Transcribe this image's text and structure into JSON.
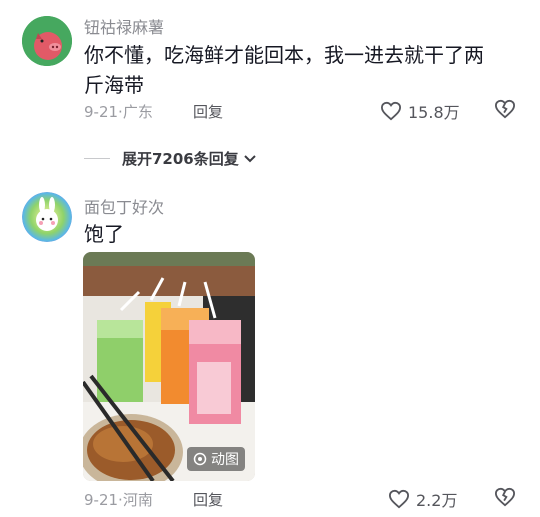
{
  "comments": [
    {
      "username": "钮祜禄麻薯",
      "content_line1": "你不懂，吃海鲜才能回本，我一进去就干了两",
      "content_line2": "斤海带",
      "date": "9-21·",
      "location": "广东",
      "reply_label": "回复",
      "likes": "15.8万"
    },
    {
      "username": "面包丁好次",
      "content": "饱了",
      "date": "9-21·",
      "location": "河南",
      "reply_label": "回复",
      "likes": "2.2万",
      "media_badge": "动图"
    }
  ],
  "expand_replies": {
    "label": "展开7206条回复"
  },
  "colors": {
    "text": "#161823",
    "muted": "#9a9ba1",
    "username": "#8a8b91"
  },
  "icons": [
    "heart-icon",
    "broken-heart-icon",
    "chevron-down-icon",
    "gif-icon"
  ]
}
